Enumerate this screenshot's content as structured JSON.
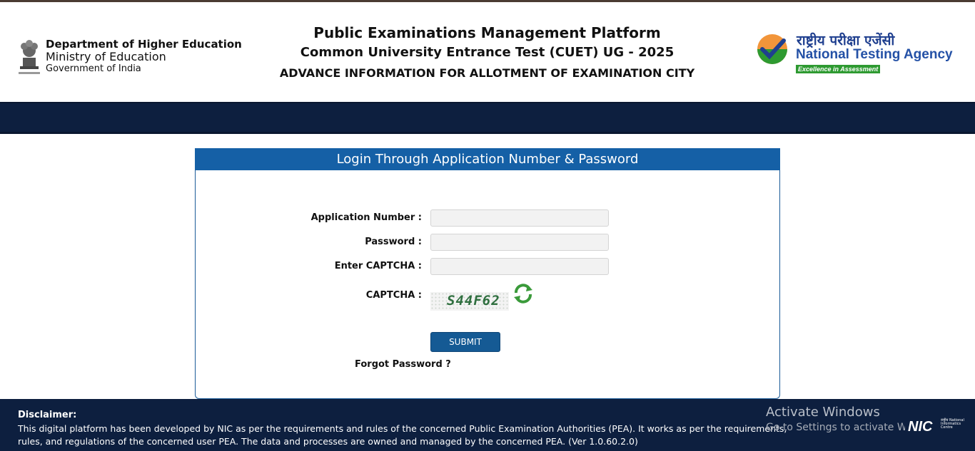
{
  "header": {
    "dept_line1": "Department of Higher Education",
    "dept_line2": "Ministry of Education",
    "dept_line3": "Government of India",
    "title1": "Public Examinations Management Platform",
    "title2": "Common University Entrance Test (CUET) UG - 2025",
    "title3": "ADVANCE INFORMATION FOR ALLOTMENT OF EXAMINATION CITY",
    "nta_hindi": "राष्ट्रीय परीक्षा एजेंसी",
    "nta_name": "National Testing Agency",
    "nta_tagline": "Excellence in Assessment"
  },
  "login": {
    "heading": "Login Through Application Number & Password",
    "app_number_label": "Application Number :",
    "app_number_value": "",
    "password_label": "Password :",
    "password_value": "",
    "captcha_input_label": "Enter CAPTCHA :",
    "captcha_input_value": "",
    "captcha_label": "CAPTCHA :",
    "captcha_text": "S44F62",
    "submit_label": "SUBMIT",
    "forgot_label": "Forgot Password ?"
  },
  "footer": {
    "disclaimer_title": "Disclaimer:",
    "disclaimer_text": "This digital platform has been developed by NIC as per the requirements and rules of the concerned Public Examination Authorities (PEA). It works as per the requirements, rules, and regulations of the concerned user PEA. The data and processes are owned and managed by the concerned PEA. (Ver 1.0.60.2.0)",
    "activate_title": "Activate Windows",
    "activate_sub": "Go to Settings to activate Windows.",
    "nic_logo": "NIC",
    "nic_sub": "राष्ट्रीय National Informatics Centre"
  },
  "colors": {
    "navy": "#0d1f3f",
    "panel_blue": "#1560a6",
    "nta_green": "#2e9a31",
    "nta_blue": "#2451a6"
  }
}
